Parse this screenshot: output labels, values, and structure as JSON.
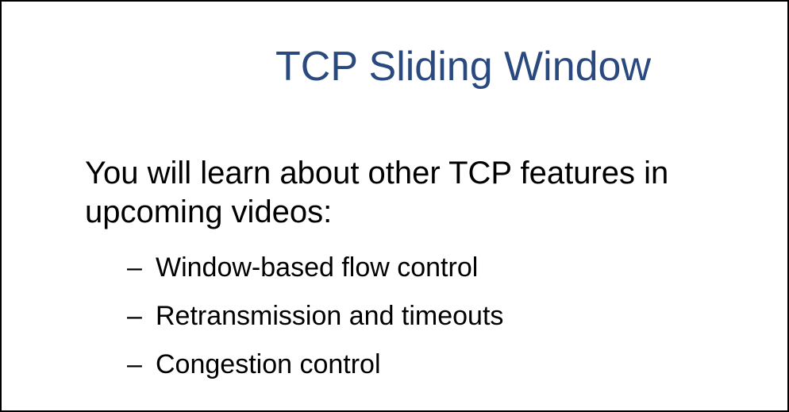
{
  "slide": {
    "title": "TCP Sliding Window",
    "main_point": "You will learn about other TCP features in upcoming videos:",
    "bullet_marker": "–",
    "sub_items": [
      "Window-based flow control",
      "Retransmission and timeouts",
      "Congestion control"
    ]
  },
  "colors": {
    "title": "#2a4a7f",
    "text": "#000000",
    "background": "#ffffff",
    "border": "#000000"
  }
}
